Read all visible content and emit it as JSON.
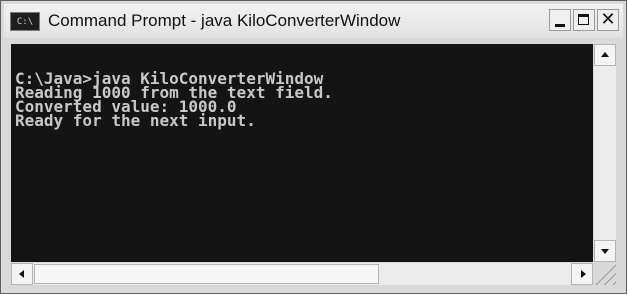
{
  "window": {
    "title": "Command Prompt - java  KiloConverterWindow",
    "icon_label": "C:\\",
    "icon_name": "command-prompt-icon"
  },
  "console": {
    "lines": [
      "C:\\Java>java KiloConverterWindow",
      "Reading 1000 from the text field.",
      "Converted value: 1000.0",
      "Ready for the next input."
    ],
    "background_color": "#141414",
    "text_color": "#c8c8c8"
  },
  "controls": {
    "minimize_icon": "minimize-icon",
    "maximize_icon": "maximize-icon",
    "close_icon": "close-icon",
    "close_glyph": "✕"
  }
}
